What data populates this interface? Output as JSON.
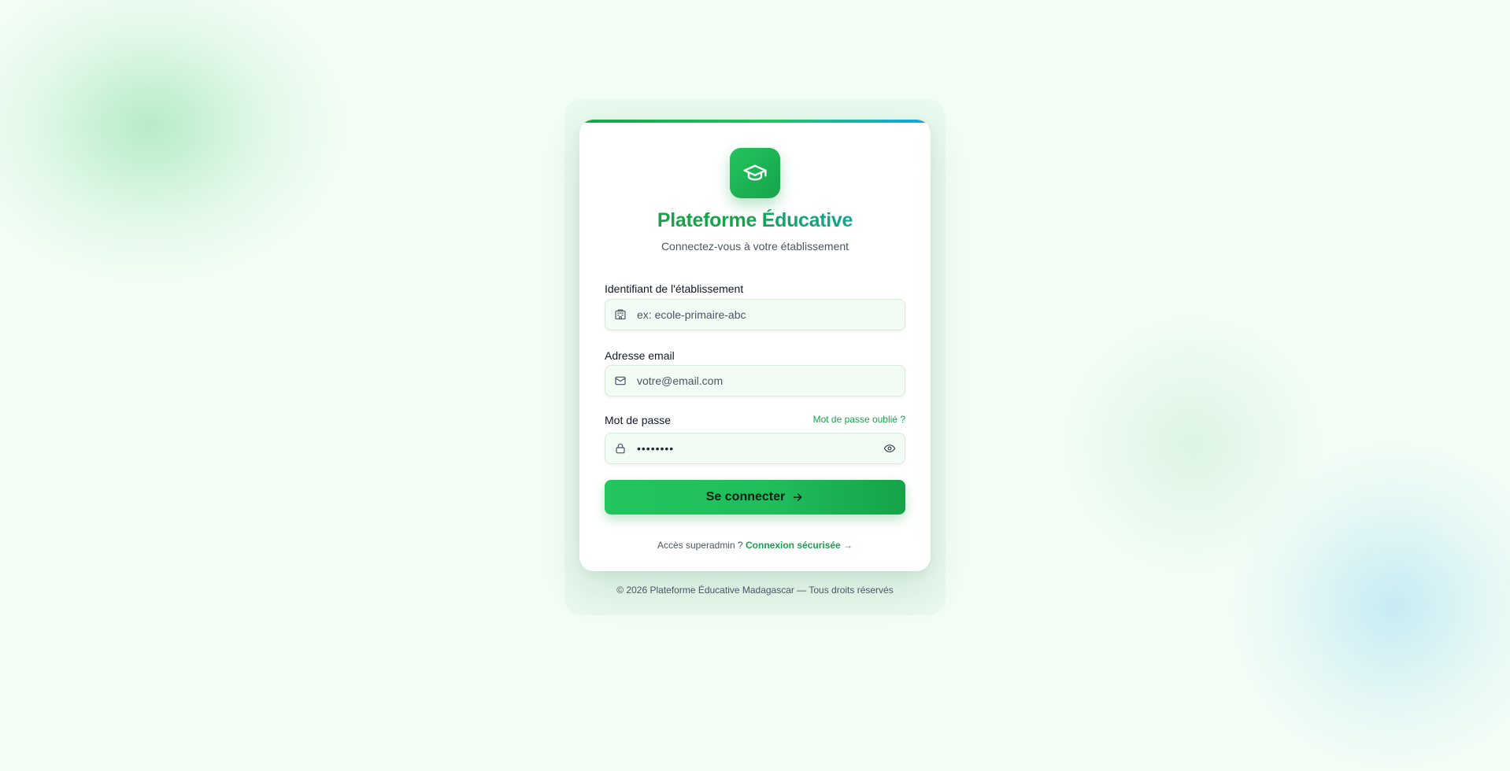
{
  "brand": {
    "title": "Plateforme Éducative",
    "subtitle": "Connectez-vous à votre établissement",
    "logo_icon": "graduation-cap-icon",
    "colors": {
      "accent": "#16a34a",
      "accent_light": "#22c55e",
      "accent_secondary": "#0ea5e9",
      "background": "#f2fdf5"
    }
  },
  "form": {
    "institution": {
      "label": "Identifiant de l'établissement",
      "placeholder": "ex: ecole-primaire-abc",
      "value": "",
      "icon": "building-icon"
    },
    "email": {
      "label": "Adresse email",
      "placeholder": "votre@email.com",
      "value": "",
      "icon": "mail-icon"
    },
    "password": {
      "label": "Mot de passe",
      "forgot_label": "Mot de passe oublié ?",
      "value": "••••••••",
      "icon": "lock-icon",
      "toggle_icon": "eye-icon"
    },
    "submit": {
      "label": "Se connecter",
      "icon": "arrow-right-icon"
    }
  },
  "superadmin": {
    "prompt": "Accès superadmin ?",
    "link_label": "Connexion sécurisée →"
  },
  "footer": {
    "text": "© 2026 Plateforme Éducative Madagascar — Tous droits réservés"
  }
}
